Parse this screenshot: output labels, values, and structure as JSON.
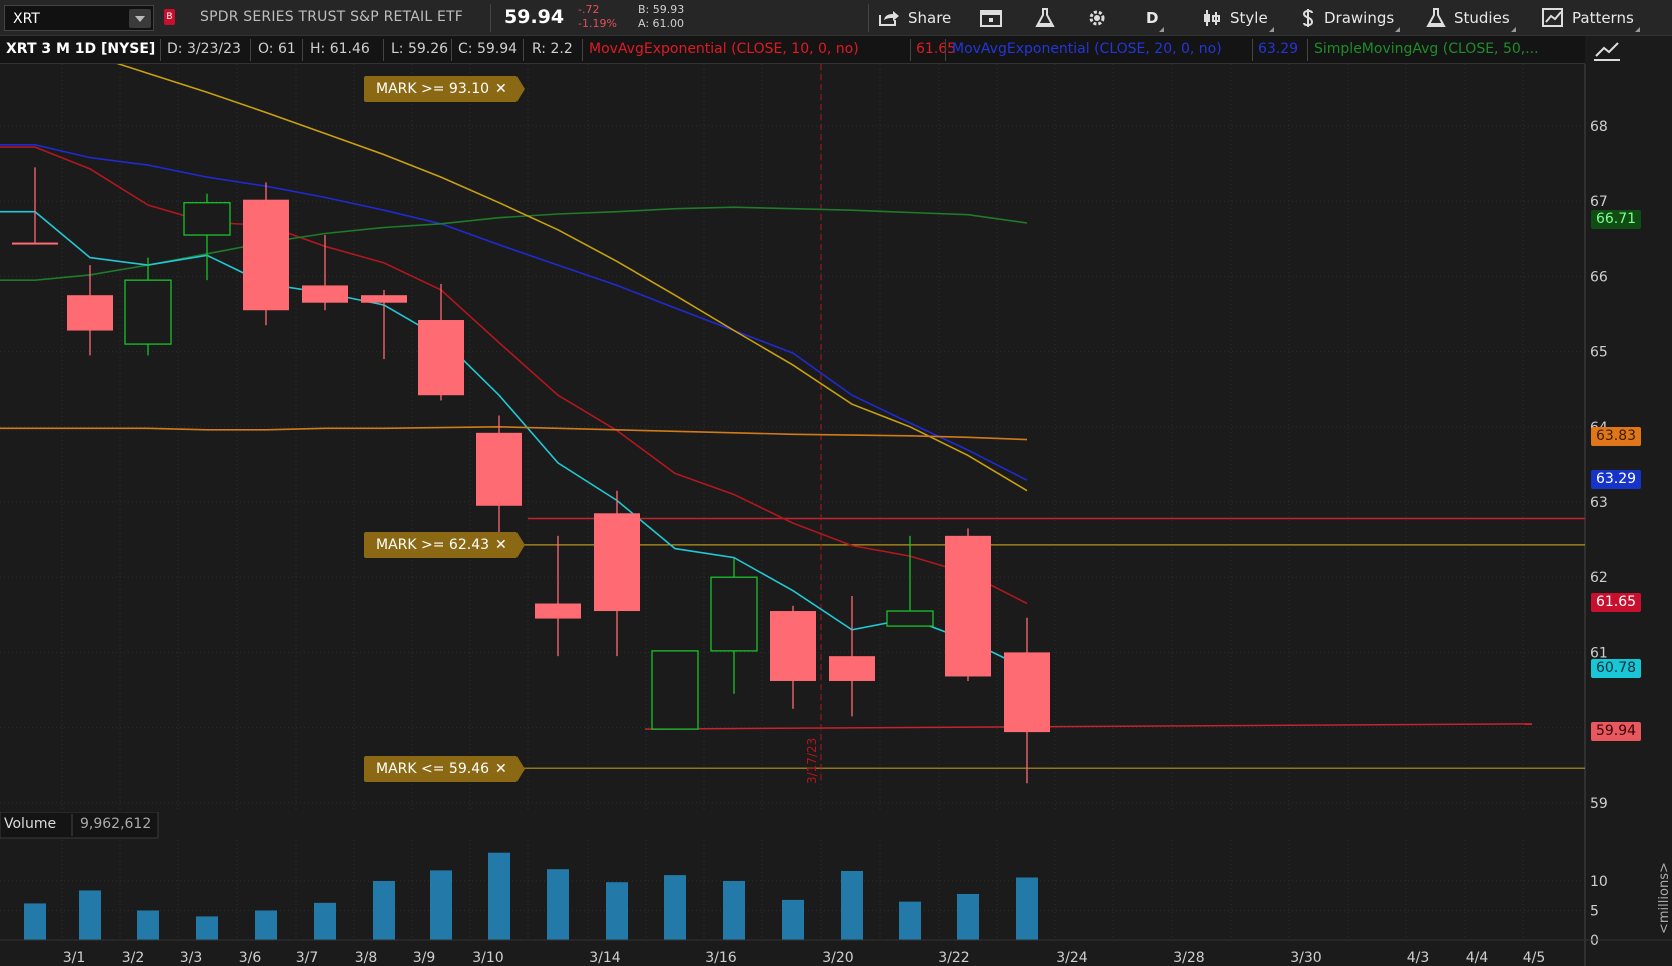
{
  "toolbar": {
    "symbol": "XRT",
    "flag": "B",
    "description": "SPDR SERIES TRUST S&P RETAIL ETF",
    "last": "59.94",
    "change": "-.72",
    "change_pct": "-1.19%",
    "bid": "B: 59.93",
    "ask": "A: 61.00",
    "buttons": {
      "share": "Share",
      "period": "D",
      "style": "Style",
      "drawings": "Drawings",
      "studies": "Studies",
      "patterns": "Patterns"
    }
  },
  "infobar": {
    "chart_title": "XRT 3 M 1D [NYSE]",
    "date": "D: 3/23/23",
    "open": "O: 61",
    "high": "H: 61.46",
    "low": "L: 59.26",
    "close": "C: 59.94",
    "range": "R: 2.2",
    "ema10_label": "MovAvgExponential (CLOSE, 10, 0, no)",
    "ema10_value": "61.65",
    "ema20_label": "MovAvgExponential (CLOSE, 20, 0, no)",
    "ema20_value": "63.29",
    "sma50_label": "SimpleMovingAvg (CLOSE, 50,..."
  },
  "marks": [
    {
      "label": "MARK >= 93.10",
      "close": "✕"
    },
    {
      "label": "MARK >= 62.43",
      "close": "✕"
    },
    {
      "label": "MARK <= 59.46",
      "close": "✕"
    }
  ],
  "price_tags": [
    {
      "value": "66.71",
      "bg": "#0f4d14",
      "fg": "#7dff8a"
    },
    {
      "value": "63.83",
      "bg": "#e0761a",
      "fg": "#3a1d00"
    },
    {
      "value": "63.29",
      "bg": "#1634c9",
      "fg": "#ffffff"
    },
    {
      "value": "61.65",
      "bg": "#c8102e",
      "fg": "#ffffff"
    },
    {
      "value": "60.78",
      "bg": "#19c6d6",
      "fg": "#003238"
    },
    {
      "value": "59.94",
      "bg": "#e8585f",
      "fg": "#3a0006"
    }
  ],
  "volume": {
    "label": "Volume",
    "value": "9,962,612",
    "unit_label": "<millions>"
  },
  "cursor_date": "3/17/23",
  "colors": {
    "up": "#19c32a",
    "down": "#ff6b73",
    "ema10": "#b0171f",
    "ema20": "#1f2ad1",
    "sma50": "#1f7a2a",
    "sma_orange": "#d07a1d",
    "sma_gold": "#c9a10e",
    "ema_cyan": "#21c8d4",
    "mark_line": "#b8941a",
    "hline_red": "#c22430",
    "volume_bar": "#2379a8"
  },
  "chart_data": {
    "type": "candlestick",
    "y_ticks": [
      "68",
      "67",
      "66",
      "65",
      "64",
      "63",
      "62",
      "61",
      "60",
      "59"
    ],
    "ylim": [
      59,
      68.5
    ],
    "volume_ticks": [
      "10",
      "5",
      "0"
    ],
    "volume_ylim": [
      0,
      15
    ],
    "x_ticks": [
      "3/1",
      "3/2",
      "3/3",
      "3/6",
      "3/7",
      "3/8",
      "3/9",
      "3/10",
      "3/14",
      "3/16",
      "3/20",
      "3/22",
      "3/24",
      "3/28",
      "3/30",
      "4/3",
      "4/4",
      "4/5"
    ],
    "candles": [
      {
        "date": "2/28",
        "o": 66.45,
        "h": 67.45,
        "l": 66.45,
        "c": 66.45
      },
      {
        "date": "3/1",
        "o": 65.75,
        "h": 66.15,
        "l": 64.95,
        "c": 65.28
      },
      {
        "date": "3/2",
        "o": 65.1,
        "h": 66.25,
        "l": 64.95,
        "c": 65.95
      },
      {
        "date": "3/3",
        "o": 66.55,
        "h": 67.1,
        "l": 65.95,
        "c": 66.98
      },
      {
        "date": "3/6",
        "o": 67.02,
        "h": 67.25,
        "l": 65.35,
        "c": 65.55
      },
      {
        "date": "3/7",
        "o": 65.88,
        "h": 66.55,
        "l": 65.55,
        "c": 65.65
      },
      {
        "date": "3/8",
        "o": 65.75,
        "h": 65.82,
        "l": 64.9,
        "c": 65.65
      },
      {
        "date": "3/9",
        "o": 65.42,
        "h": 65.9,
        "l": 64.35,
        "c": 64.42
      },
      {
        "date": "3/10",
        "o": 63.92,
        "h": 64.15,
        "l": 62.55,
        "c": 62.95
      },
      {
        "date": "3/13",
        "o": 61.65,
        "h": 62.55,
        "l": 60.95,
        "c": 61.45
      },
      {
        "date": "3/14",
        "o": 62.85,
        "h": 63.15,
        "l": 60.95,
        "c": 61.55
      },
      {
        "date": "3/15",
        "o": 59.98,
        "h": 60.45,
        "l": 59.98,
        "c": 61.02
      },
      {
        "date": "3/16",
        "o": 61.02,
        "h": 62.25,
        "l": 60.45,
        "c": 62.0
      },
      {
        "date": "3/17",
        "o": 61.55,
        "h": 61.62,
        "l": 60.25,
        "c": 60.62
      },
      {
        "date": "3/20",
        "o": 60.95,
        "h": 61.75,
        "l": 60.15,
        "c": 60.62
      },
      {
        "date": "3/21",
        "o": 61.35,
        "h": 62.55,
        "l": 61.35,
        "c": 61.55
      },
      {
        "date": "3/22",
        "o": 62.55,
        "h": 62.65,
        "l": 60.62,
        "c": 60.68
      },
      {
        "date": "3/23",
        "o": 61.0,
        "h": 61.46,
        "l": 59.26,
        "c": 59.94
      }
    ],
    "volume_millions": [
      6.2,
      8.4,
      5.0,
      4.0,
      5.0,
      6.3,
      10.0,
      11.8,
      14.8,
      12.0,
      9.8,
      11.0,
      10.0,
      6.8,
      11.7,
      6.5,
      7.8,
      10.6
    ],
    "series": [
      {
        "name": "MovAvgExponential (CLOSE, 10, 0, no)",
        "values": [
          67.72,
          67.43,
          66.95,
          66.72,
          66.68,
          66.4,
          66.18,
          65.82,
          65.12,
          64.42,
          63.95,
          63.38,
          63.1,
          62.72,
          62.42,
          62.28,
          62.05,
          61.65
        ]
      },
      {
        "name": "MovAvgExponential (CLOSE, 20, 0, no)",
        "values": [
          67.75,
          67.58,
          67.48,
          67.32,
          67.2,
          67.05,
          66.88,
          66.7,
          66.42,
          66.15,
          65.88,
          65.58,
          65.28,
          64.98,
          64.42,
          64.05,
          63.69,
          63.29
        ]
      },
      {
        "name": "SimpleMovingAvg (CLOSE, 50,...",
        "values": [
          65.95,
          66.02,
          66.15,
          66.3,
          66.45,
          66.57,
          66.65,
          66.7,
          66.78,
          66.83,
          66.86,
          66.9,
          66.92,
          66.9,
          66.88,
          66.85,
          66.82,
          66.71
        ]
      },
      {
        "name": "ema_cyan",
        "values": [
          66.86,
          66.25,
          66.15,
          66.28,
          65.9,
          65.78,
          65.62,
          65.18,
          64.42,
          63.52,
          63.02,
          62.38,
          62.26,
          61.82,
          61.3,
          61.45,
          61.16,
          60.78
        ]
      },
      {
        "name": "sma_gold",
        "values": [
          69.2,
          68.95,
          68.7,
          68.45,
          68.18,
          67.9,
          67.62,
          67.32,
          66.98,
          66.62,
          66.2,
          65.75,
          65.28,
          64.82,
          64.3,
          64.0,
          63.62,
          63.15
        ]
      },
      {
        "name": "sma_orange",
        "values": [
          63.98,
          63.98,
          63.98,
          63.96,
          63.96,
          63.98,
          63.98,
          63.99,
          64.0,
          63.98,
          63.96,
          63.94,
          63.92,
          63.9,
          63.89,
          63.88,
          63.86,
          63.83
        ]
      }
    ],
    "marks": [
      {
        "label": "MARK >= 93.10"
      },
      {
        "label": "MARK >= 62.43",
        "value": 62.43
      },
      {
        "label": "MARK <= 59.46",
        "value": 59.46
      }
    ],
    "horizontal_lines": [
      {
        "from": "3/13",
        "to": "4/5",
        "value": 62.78
      },
      {
        "from": "3/15",
        "to": "4/5",
        "value": 59.98,
        "end_value": 60.05
      }
    ]
  }
}
